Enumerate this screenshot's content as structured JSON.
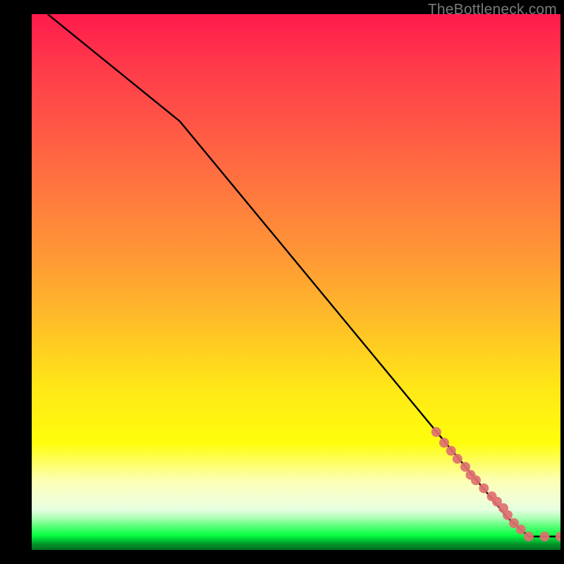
{
  "watermark": "TheBottleneck.com",
  "chart_data": {
    "type": "line",
    "title": "",
    "xlabel": "",
    "ylabel": "",
    "xlim": [
      0,
      100
    ],
    "ylim": [
      0,
      100
    ],
    "grid": false,
    "legend": false,
    "series": [
      {
        "name": "black-curve",
        "type": "line",
        "color": "#000000",
        "x": [
          3,
          28,
          90,
          94,
          100
        ],
        "y": [
          100,
          80,
          6,
          2.5,
          2.5
        ]
      },
      {
        "name": "pink-dots",
        "type": "scatter",
        "color": "#e07070",
        "x": [
          76.5,
          78.0,
          79.3,
          80.5,
          82.0,
          83.0,
          84.0,
          85.5,
          87.0,
          88.0,
          89.2,
          90.0,
          91.2,
          92.5,
          94.0,
          97.0,
          100.0
        ],
        "y": [
          22.0,
          20.0,
          18.5,
          17.0,
          15.5,
          14.0,
          13.0,
          11.5,
          10.0,
          9.0,
          7.8,
          6.5,
          5.0,
          3.8,
          2.5,
          2.5,
          2.5
        ]
      }
    ]
  }
}
